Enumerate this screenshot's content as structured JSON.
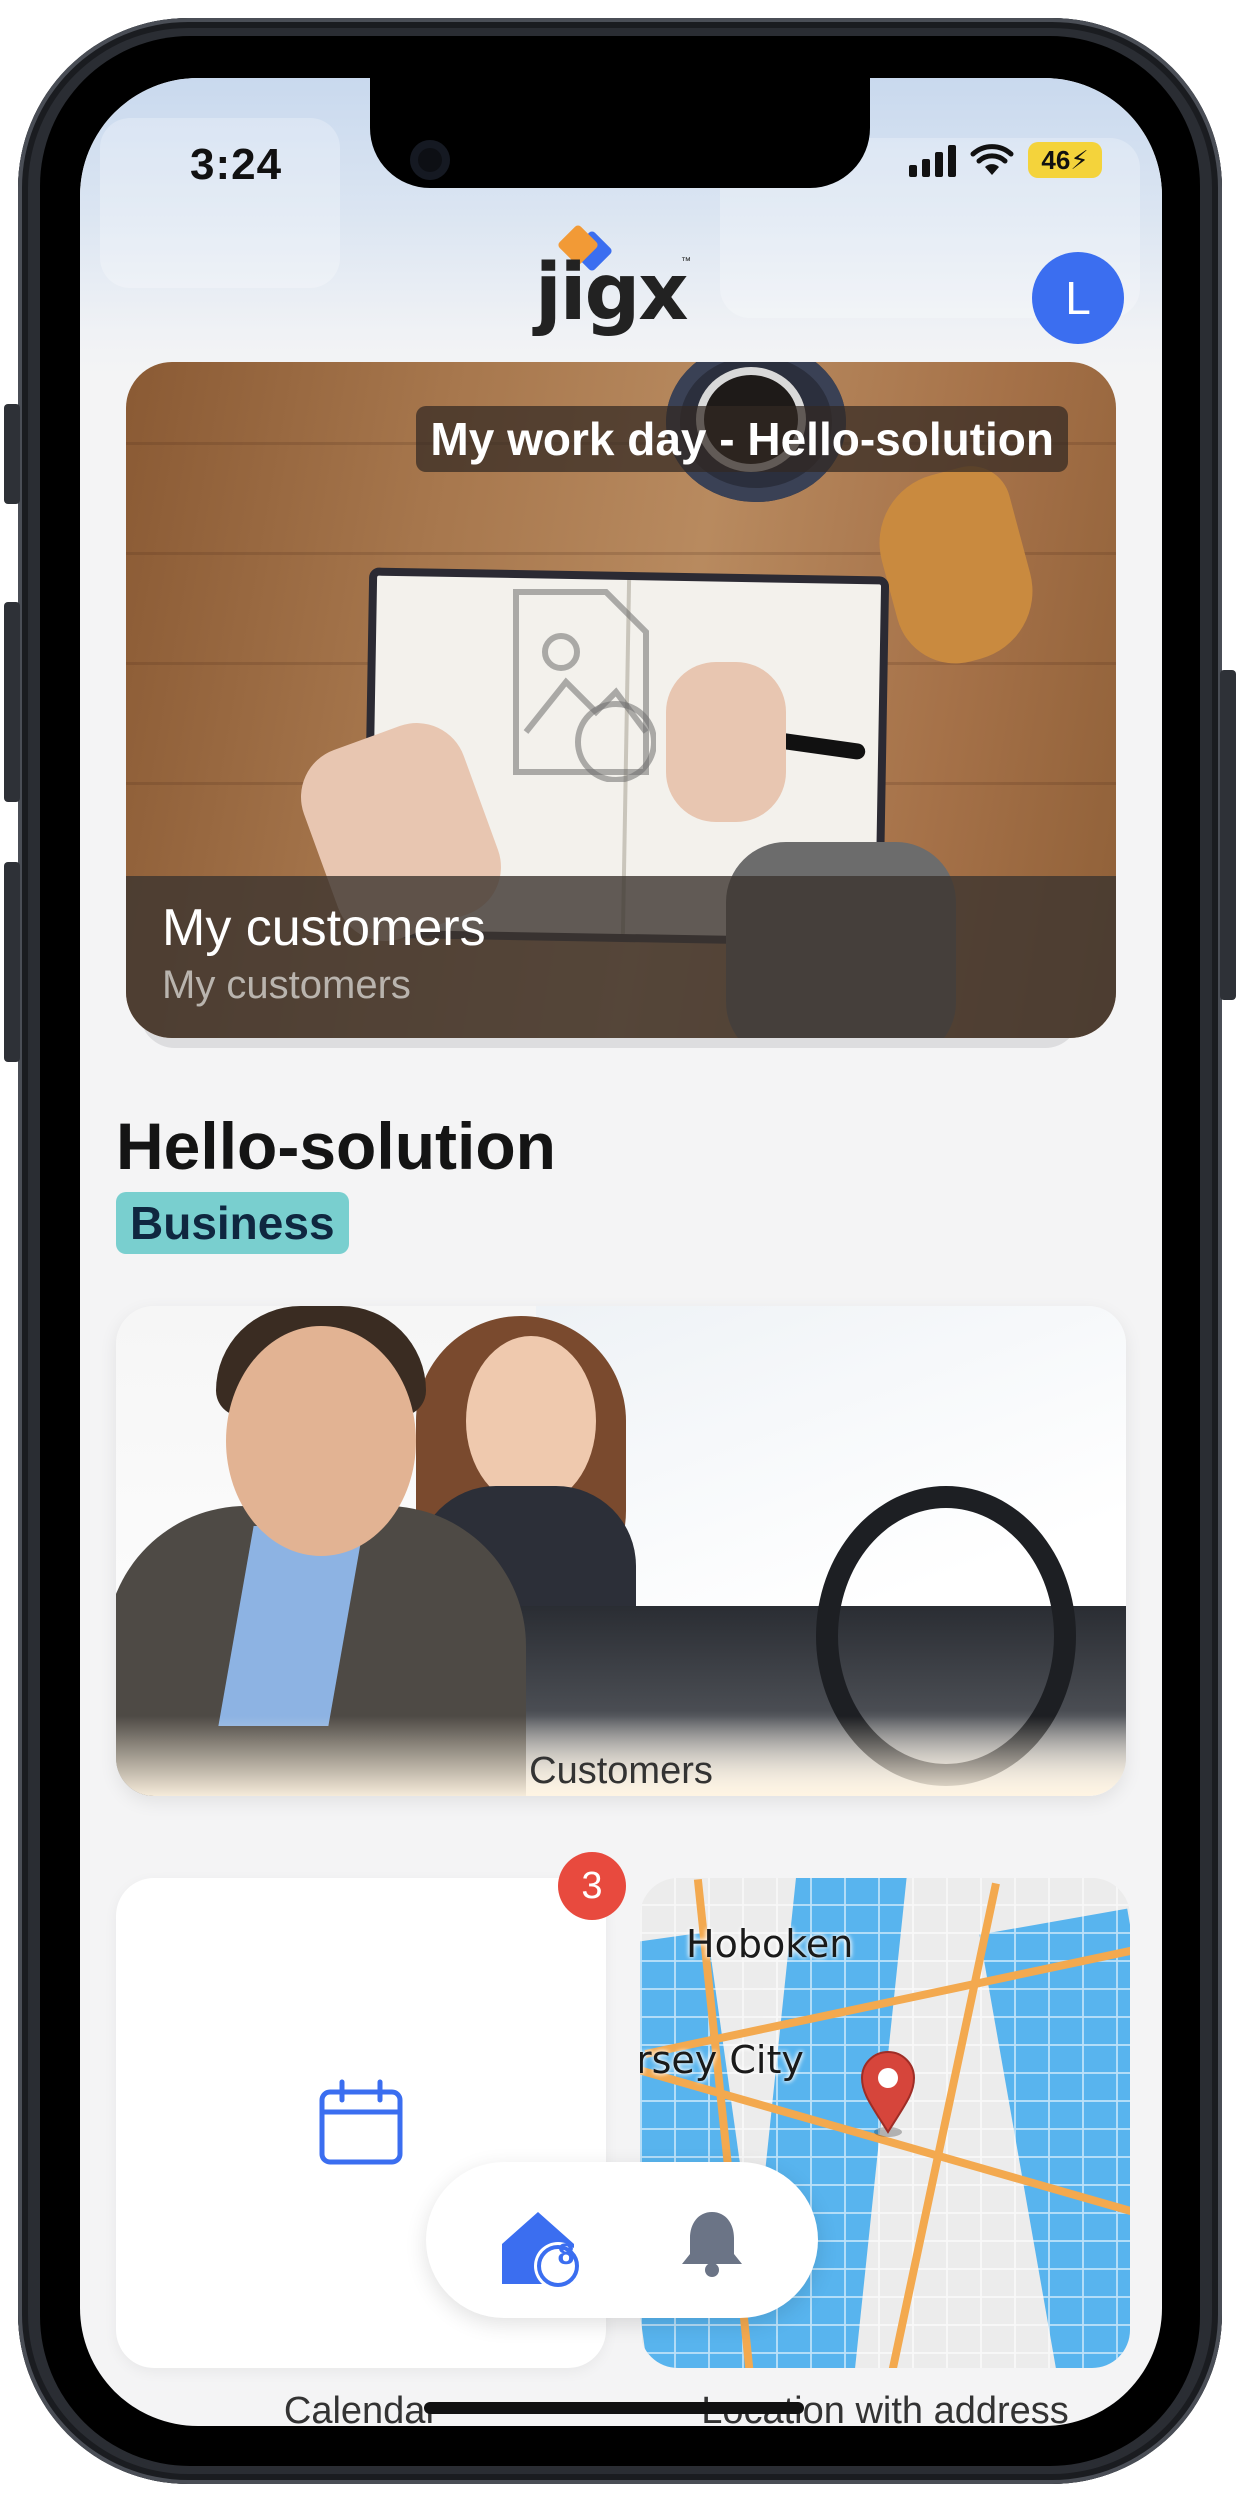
{
  "status_bar": {
    "time": "3:24",
    "battery": "46"
  },
  "header": {
    "logo_text": "jigx",
    "logo_tm": "™",
    "avatar_initial": "L",
    "avatar_color": "#3b6ef0"
  },
  "hero": {
    "title": "My work day - Hello-solution",
    "caption_title": "My customers",
    "caption_subtitle": "My customers"
  },
  "solution": {
    "title": "Hello-solution",
    "badge": "Business",
    "badge_color": "#79cfcf"
  },
  "tiles": {
    "customers_label": "Customers",
    "calendar_label": "Calendar",
    "calendar_badge_count": "3",
    "location_label": "Location with address",
    "map_labels": [
      "Hoboken",
      "rsey City"
    ]
  },
  "bottom_nav": {
    "home_icon": "home-icon",
    "home_badge": "8",
    "bell_icon": "bell-icon",
    "accent": "#3b6ef0"
  }
}
